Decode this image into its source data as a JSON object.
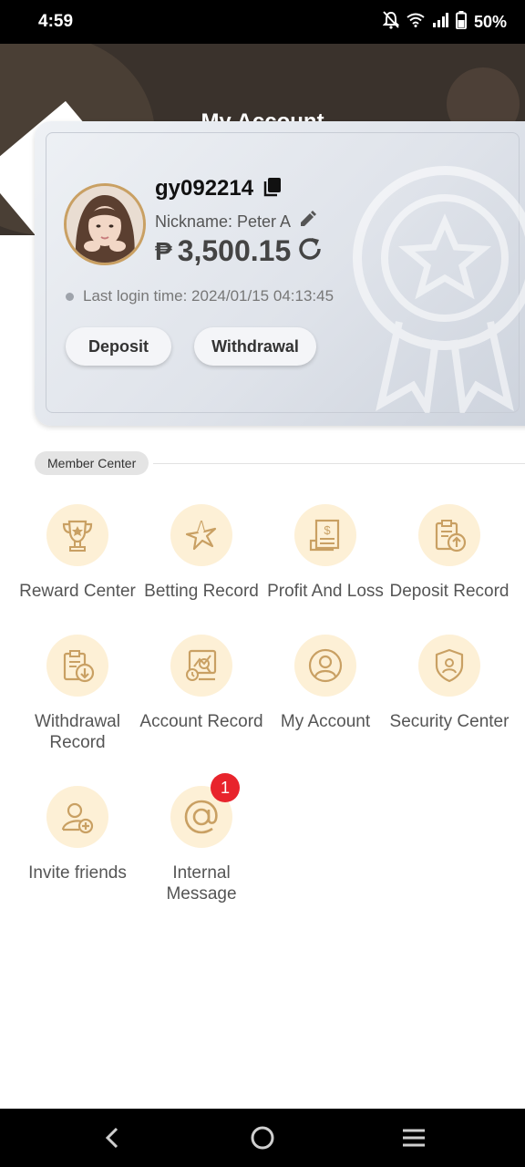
{
  "status_bar": {
    "time": "4:59",
    "battery": "50%"
  },
  "header": {
    "title": "My Account"
  },
  "profile": {
    "username": "gy092214",
    "nickname": "Nickname: Peter A",
    "currency_symbol": "₱",
    "balance": "3,500.15",
    "last_login": "Last login time: 2024/01/15 04:13:45",
    "deposit_label": "Deposit",
    "withdrawal_label": "Withdrawal"
  },
  "member_center": {
    "title": "Member Center",
    "items": [
      {
        "label": "Reward Center",
        "icon": "trophy-icon"
      },
      {
        "label": "Betting Record",
        "icon": "star-burst-icon"
      },
      {
        "label": "Profit And Loss",
        "icon": "dollar-document-icon"
      },
      {
        "label": "Deposit Record",
        "icon": "clipboard-upload-icon"
      },
      {
        "label": "Withdrawal Record",
        "icon": "clipboard-download-icon"
      },
      {
        "label": "Account Record",
        "icon": "monitor-chart-icon"
      },
      {
        "label": "My Account",
        "icon": "user-circle-icon"
      },
      {
        "label": "Security Center",
        "icon": "shield-user-icon"
      },
      {
        "label": "Invite friends",
        "icon": "user-plus-icon"
      },
      {
        "label": "Internal Message",
        "icon": "at-sign-icon",
        "badge": "1"
      }
    ]
  },
  "colors": {
    "accent": "#c9a063",
    "icon_bg": "#fdf0d6",
    "header_bg": "#3a322c",
    "badge_red": "#e8242c"
  }
}
